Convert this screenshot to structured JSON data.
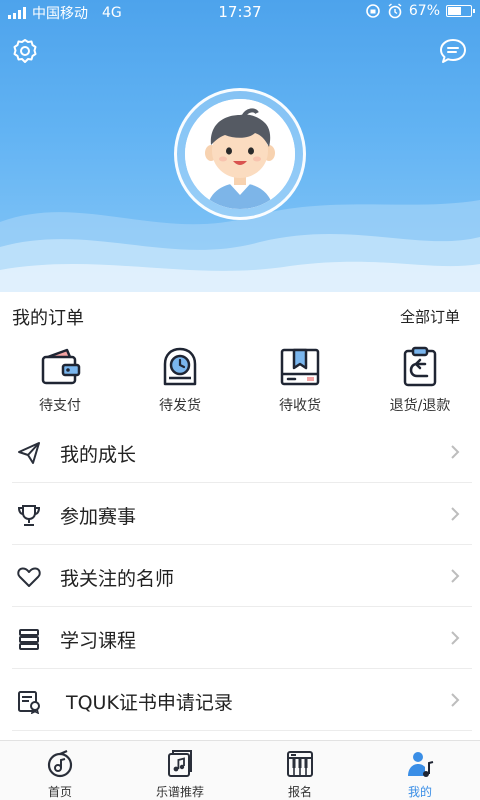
{
  "status_bar": {
    "carrier": "中国移动",
    "network": "4G",
    "time": "17:37",
    "battery_percent_text": "67%",
    "battery_level": 0.67
  },
  "header": {
    "icons": {
      "settings": "settings-icon",
      "messages": "message-bubble-icon"
    }
  },
  "orders": {
    "title": "我的订单",
    "all_label": "全部订单",
    "items": [
      {
        "label": "待支付",
        "icon": "wallet-icon"
      },
      {
        "label": "待发货",
        "icon": "clock-box-icon"
      },
      {
        "label": "待收货",
        "icon": "package-icon"
      },
      {
        "label": "退货/退款",
        "icon": "return-clipboard-icon"
      }
    ]
  },
  "menu": [
    {
      "label": "我的成长",
      "icon": "paper-plane-icon"
    },
    {
      "label": "参加赛事",
      "icon": "trophy-icon"
    },
    {
      "label": "我关注的名师",
      "icon": "heart-icon"
    },
    {
      "label": "学习课程",
      "icon": "book-stack-icon"
    },
    {
      "label": "TQUK证书申请记录",
      "icon": "certificate-icon"
    }
  ],
  "tabbar": {
    "active_index": 3,
    "tabs": [
      {
        "label": "首页",
        "icon": "music-disc-icon"
      },
      {
        "label": "乐谱推荐",
        "icon": "sheet-music-icon"
      },
      {
        "label": "报名",
        "icon": "piano-icon"
      },
      {
        "label": "我的",
        "icon": "profile-music-icon"
      }
    ]
  },
  "colors": {
    "header_top": "#4da3ec",
    "header_bottom": "#88c8f7",
    "accent": "#3a8ee6",
    "icon_dark": "#1f2533"
  }
}
